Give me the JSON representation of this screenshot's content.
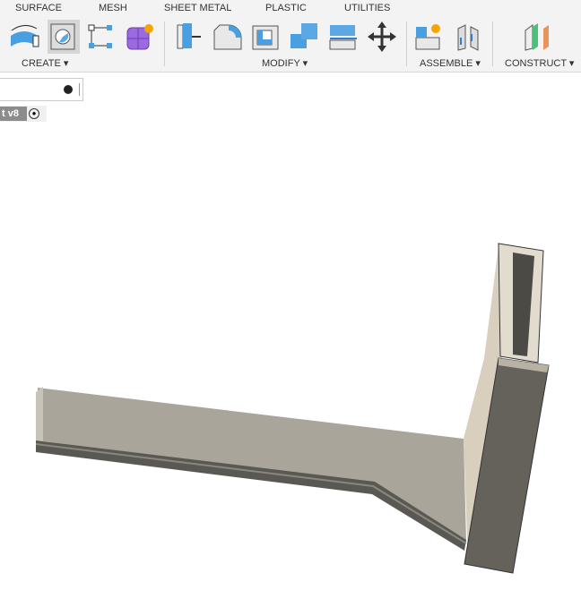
{
  "tabs": [
    "SURFACE",
    "MESH",
    "SHEET METAL",
    "PLASTIC",
    "UTILITIES"
  ],
  "groups": {
    "create": "CREATE ▾",
    "modify": "MODIFY ▾",
    "assemble": "ASSEMBLE ▾",
    "construct": "CONSTRUCT ▾"
  },
  "document": {
    "name": "t v8"
  }
}
